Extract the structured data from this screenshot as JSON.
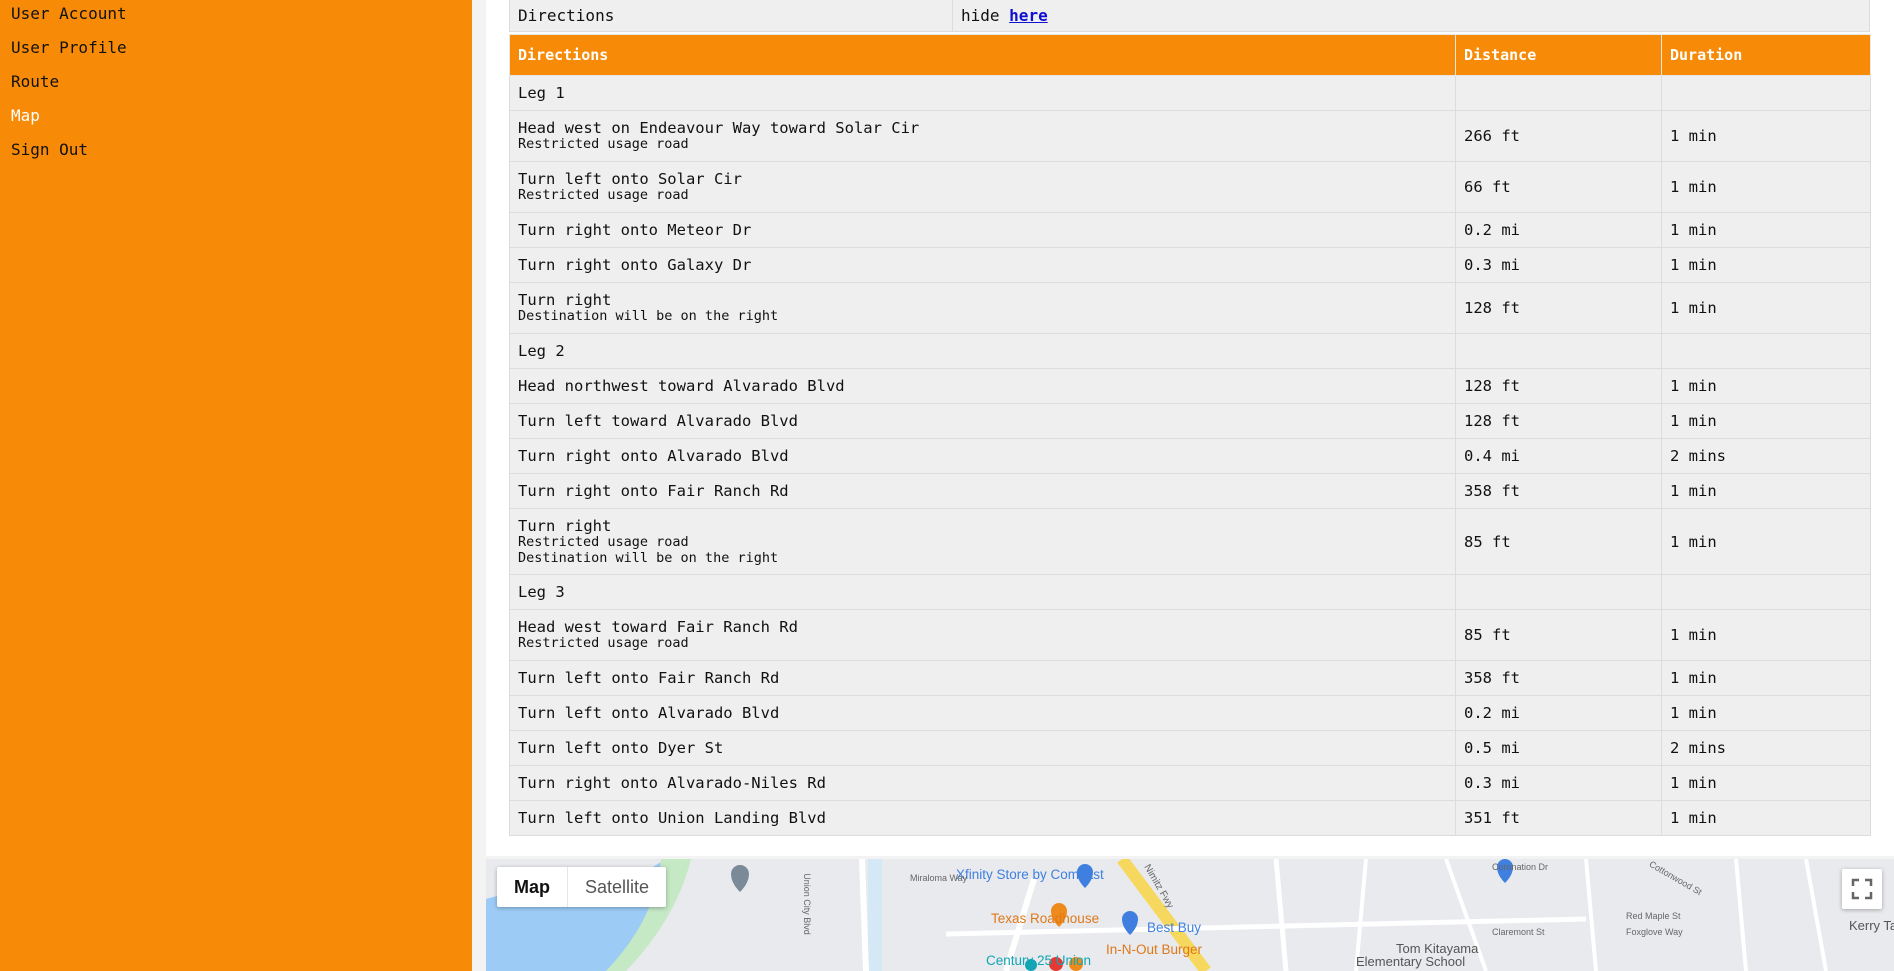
{
  "nav": {
    "items": [
      {
        "label": "User Account",
        "active": false
      },
      {
        "label": "User Profile",
        "active": false
      },
      {
        "label": "Route",
        "active": false
      },
      {
        "label": "Map",
        "active": true
      },
      {
        "label": "Sign Out",
        "active": false
      }
    ]
  },
  "directions_toggle": {
    "label": "Directions",
    "prefix": "hide",
    "link": "here"
  },
  "table": {
    "headers": [
      "Directions",
      "Distance",
      "Duration"
    ],
    "rows": [
      {
        "lines": [
          "Leg 1"
        ],
        "distance": "",
        "duration": ""
      },
      {
        "lines": [
          "Head west on Endeavour Way toward Solar Cir",
          "Restricted usage road"
        ],
        "distance": "266 ft",
        "duration": "1 min"
      },
      {
        "lines": [
          "Turn left onto Solar Cir",
          "Restricted usage road"
        ],
        "distance": "66 ft",
        "duration": "1 min"
      },
      {
        "lines": [
          "Turn right onto Meteor Dr"
        ],
        "distance": "0.2 mi",
        "duration": "1 min"
      },
      {
        "lines": [
          "Turn right onto Galaxy Dr"
        ],
        "distance": "0.3 mi",
        "duration": "1 min"
      },
      {
        "lines": [
          "Turn right",
          "Destination will be on the right"
        ],
        "distance": "128 ft",
        "duration": "1 min"
      },
      {
        "lines": [
          "Leg 2"
        ],
        "distance": "",
        "duration": ""
      },
      {
        "lines": [
          "Head northwest toward Alvarado Blvd"
        ],
        "distance": "128 ft",
        "duration": "1 min"
      },
      {
        "lines": [
          "Turn left toward Alvarado Blvd"
        ],
        "distance": "128 ft",
        "duration": "1 min"
      },
      {
        "lines": [
          "Turn right onto Alvarado Blvd"
        ],
        "distance": "0.4 mi",
        "duration": "2 mins"
      },
      {
        "lines": [
          "Turn right onto Fair Ranch Rd"
        ],
        "distance": "358 ft",
        "duration": "1 min"
      },
      {
        "lines": [
          "Turn right",
          "Restricted usage road",
          "Destination will be on the right"
        ],
        "distance": "85 ft",
        "duration": "1 min"
      },
      {
        "lines": [
          "Leg 3"
        ],
        "distance": "",
        "duration": ""
      },
      {
        "lines": [
          "Head west toward Fair Ranch Rd",
          "Restricted usage road"
        ],
        "distance": "85 ft",
        "duration": "1 min"
      },
      {
        "lines": [
          "Turn left onto Fair Ranch Rd"
        ],
        "distance": "358 ft",
        "duration": "1 min"
      },
      {
        "lines": [
          "Turn left onto Alvarado Blvd"
        ],
        "distance": "0.2 mi",
        "duration": "1 min"
      },
      {
        "lines": [
          "Turn left onto Dyer St"
        ],
        "distance": "0.5 mi",
        "duration": "2 mins"
      },
      {
        "lines": [
          "Turn right onto Alvarado-Niles Rd"
        ],
        "distance": "0.3 mi",
        "duration": "1 min"
      },
      {
        "lines": [
          "Turn left onto Union Landing Blvd"
        ],
        "distance": "351 ft",
        "duration": "1 min"
      }
    ]
  },
  "map": {
    "type_buttons": [
      "Map",
      "Satellite"
    ],
    "selected_type": "Map",
    "labels": {
      "xfinity": "Xfinity Store by Comcast",
      "texas": "Texas Roadhouse",
      "bestbuy": "Best Buy",
      "innout": "In-N-Out Burger",
      "century": "Century 25 Union",
      "tomk1": "Tom Kitayama",
      "tomk2": "Elementary School",
      "kerry": "Kerry Ta",
      "union_city": "Union City Blvd",
      "nimitz": "Nimitz Fwy",
      "miraloma": "Miraloma Way",
      "coronation": "Coronation Dr",
      "red_maple": "Red Maple St",
      "foxglove": "Foxglove Way",
      "claremont": "Claremont St",
      "cottonwood": "Cottonwood St"
    },
    "colors": {
      "water": "#9ccbf5",
      "park": "#c5e8c5",
      "freeway": "#f6d85e",
      "poi_blue": "#3f7fe0",
      "poi_orange": "#ee8a1c",
      "poi_teal": "#12a5b4"
    }
  },
  "theme": {
    "accent": "#f78b08",
    "row_bg": "#efefef",
    "link": "#1010d0"
  }
}
